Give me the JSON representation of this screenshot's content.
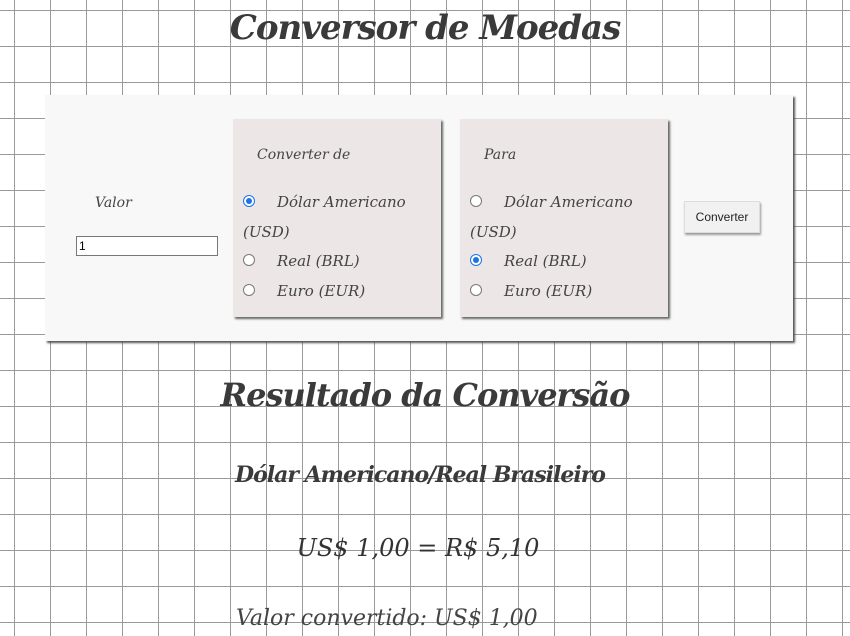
{
  "title": "Conversor de Moedas",
  "form": {
    "valor_label": "Valor",
    "valor_value": "1",
    "convert_button": "Converter",
    "from": {
      "legend": "Converter de",
      "options": [
        {
          "label": "Dólar Americano (USD)",
          "checked": true
        },
        {
          "label": "Real (BRL)",
          "checked": false
        },
        {
          "label": "Euro (EUR)",
          "checked": false
        }
      ]
    },
    "to": {
      "legend": "Para",
      "options": [
        {
          "label": "Dólar Americano (USD)",
          "checked": false
        },
        {
          "label": "Real (BRL)",
          "checked": true
        },
        {
          "label": "Euro (EUR)",
          "checked": false
        }
      ]
    }
  },
  "result": {
    "title": "Resultado da Conversão",
    "pair": "Dólar Americano/Real Brasileiro",
    "rate": "US$ 1,00 = R$ 5,10",
    "converted": "Valor convertido: US$ 1,00"
  },
  "colors": {
    "accent": "#1a73e8",
    "panel": "#f8f8f8",
    "fieldset": "#ede6e6",
    "grid": "#9a9a9a"
  }
}
